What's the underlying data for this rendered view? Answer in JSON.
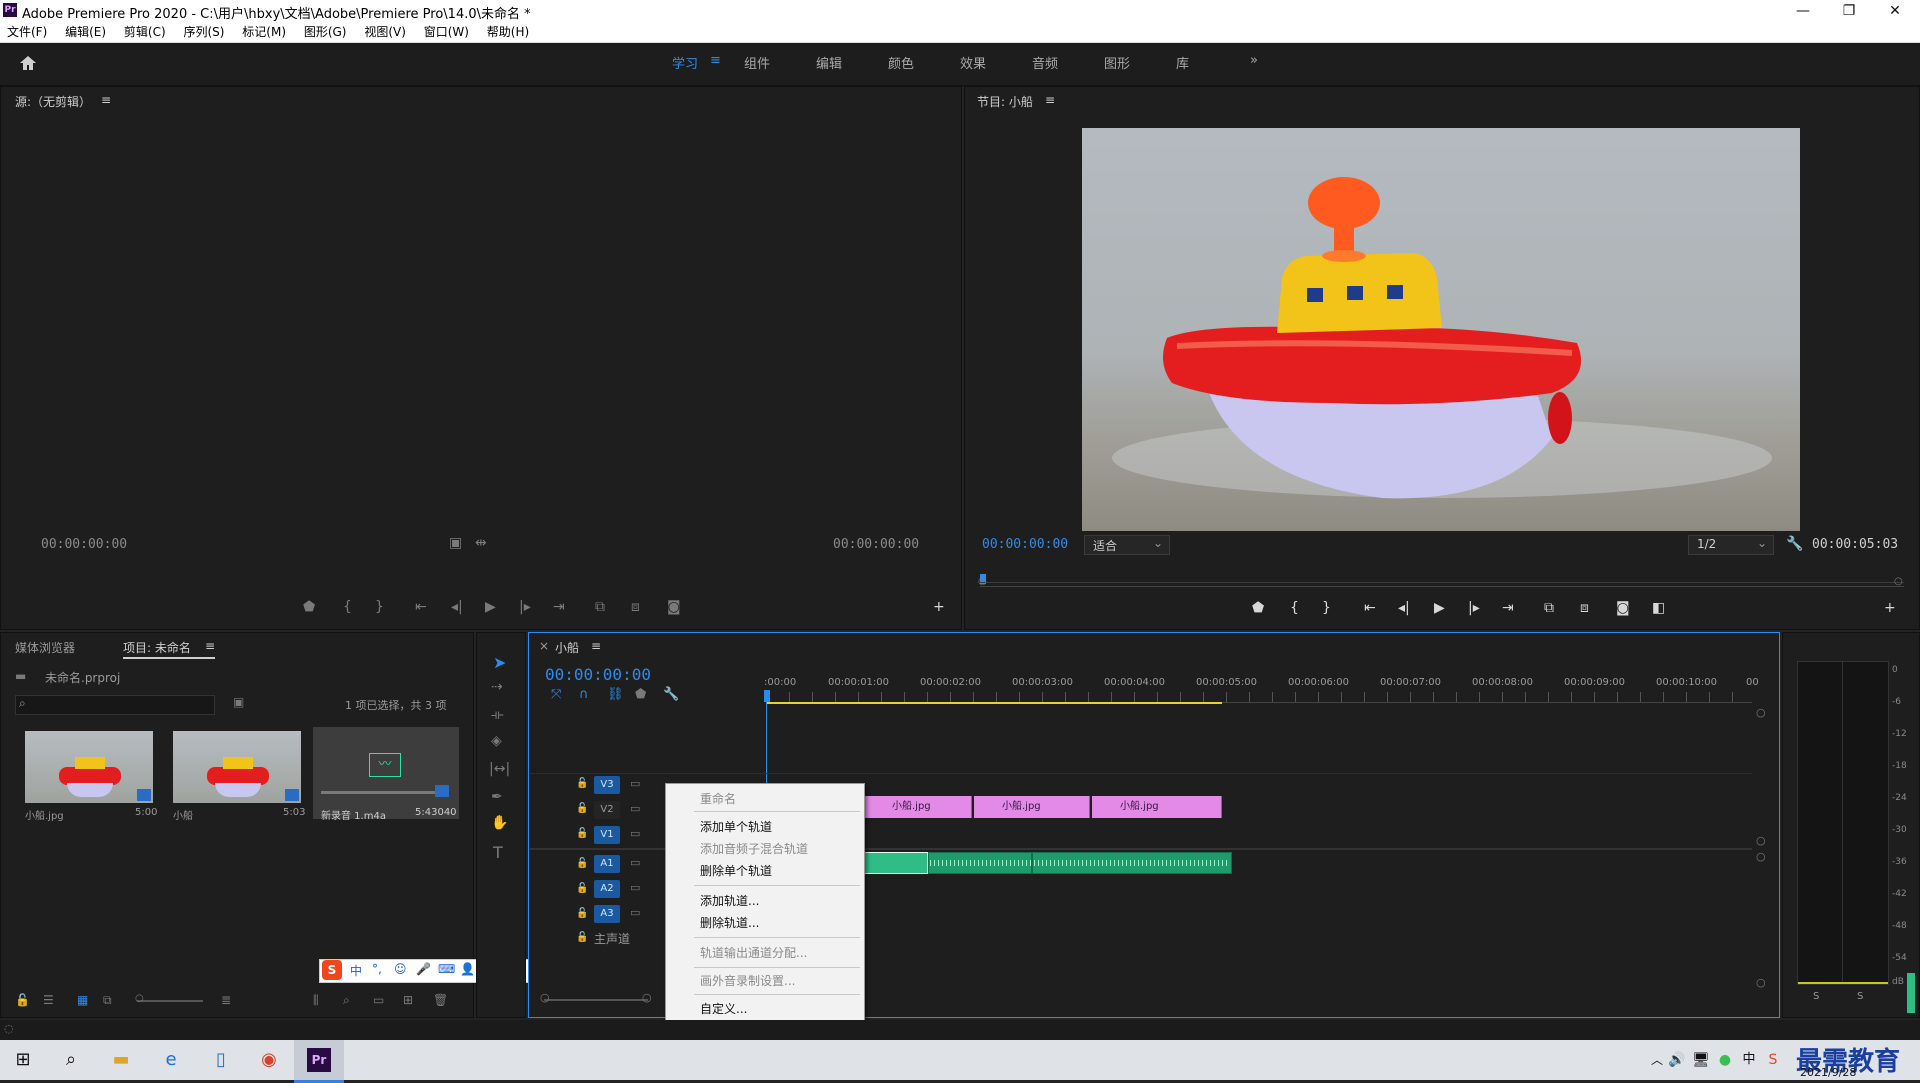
{
  "window": {
    "title": "Adobe Premiere Pro 2020 - C:\\用户\\hbxy\\文档\\Adobe\\Premiere Pro\\14.0\\未命名 *",
    "app_icon": "Pr",
    "minimize": "—",
    "restore": "❐",
    "close": "✕"
  },
  "menu": [
    "文件(F)",
    "编辑(E)",
    "剪辑(C)",
    "序列(S)",
    "标记(M)",
    "图形(G)",
    "视图(V)",
    "窗口(W)",
    "帮助(H)"
  ],
  "workspace": {
    "tabs": [
      "学习",
      "组件",
      "编辑",
      "颜色",
      "效果",
      "音频",
      "图形",
      "库"
    ],
    "active_index": 0,
    "active_menu_glyph": "≡",
    "more": "»"
  },
  "source_monitor": {
    "title": "源:（无剪辑）",
    "menu_glyph": "≡",
    "tc_left": "00:00:00:00",
    "tc_right": "00:00:00:00"
  },
  "program_monitor": {
    "title": "节目: 小船",
    "menu_glyph": "≡",
    "tc_current": "00:00:00:00",
    "fit": "适合",
    "resolution": "1/2",
    "tc_duration": "00:00:05:03"
  },
  "project_panel": {
    "tab_media": "媒体浏览器",
    "tab_project": "项目: 未命名",
    "menu_glyph": "≡",
    "project_file": "未命名.prproj",
    "selection_info": "1 项已选择，共 3 项",
    "items": [
      {
        "name": "小船.jpg",
        "duration": "5:00"
      },
      {
        "name": "小船",
        "duration": "5:03"
      },
      {
        "name": "新录音 1.m4a",
        "duration": "5:43040"
      }
    ]
  },
  "timeline": {
    "sequence_name": "小船",
    "close_glyph": "×",
    "menu_glyph": "≡",
    "timecode": "00:00:00:00",
    "ruler": [
      ":00:00",
      "00:00:01:00",
      "00:00:02:00",
      "00:00:03:00",
      "00:00:04:00",
      "00:00:05:00",
      "00:00:06:00",
      "00:00:07:00",
      "00:00:08:00",
      "00:00:09:00",
      "00:00:10:00",
      "00"
    ],
    "video_tracks": [
      "V3",
      "V2",
      "V1"
    ],
    "audio_tracks": [
      "A1",
      "A2",
      "A3"
    ],
    "master": "主声道",
    "clips": [
      "小船.jpg",
      "小船.jpg",
      "小船.jpg"
    ]
  },
  "context_menu": {
    "items": [
      {
        "label": "重命名",
        "disabled": true
      },
      {
        "label": "添加单个轨道",
        "disabled": false
      },
      {
        "label": "添加音频子混合轨道",
        "disabled": true
      },
      {
        "label": "删除单个轨道",
        "disabled": false
      },
      {
        "label": "添加轨道...",
        "disabled": false
      },
      {
        "label": "删除轨道...",
        "disabled": false
      },
      {
        "label": "轨道输出通道分配...",
        "disabled": true
      },
      {
        "label": "画外音录制设置...",
        "disabled": true
      },
      {
        "label": "自定义...",
        "disabled": false
      }
    ]
  },
  "audio_meter": {
    "scale": [
      "0",
      "-6",
      "-12",
      "-18",
      "-24",
      "-30",
      "-36",
      "-42",
      "-48",
      "-54",
      "dB"
    ],
    "solo": [
      "S",
      "S"
    ]
  },
  "ime_toolbar": [
    "中",
    "°,",
    "☺",
    "🎤",
    "⌨",
    "👤",
    "👕",
    "▦"
  ],
  "taskbar": {
    "date": "2021/9/28",
    "watermark": "最需教育",
    "ime_lang": "中"
  },
  "colors": {
    "accent": "#2d8ceb",
    "video_clip": "#e389e6",
    "audio_clip": "#1e9b6a"
  }
}
